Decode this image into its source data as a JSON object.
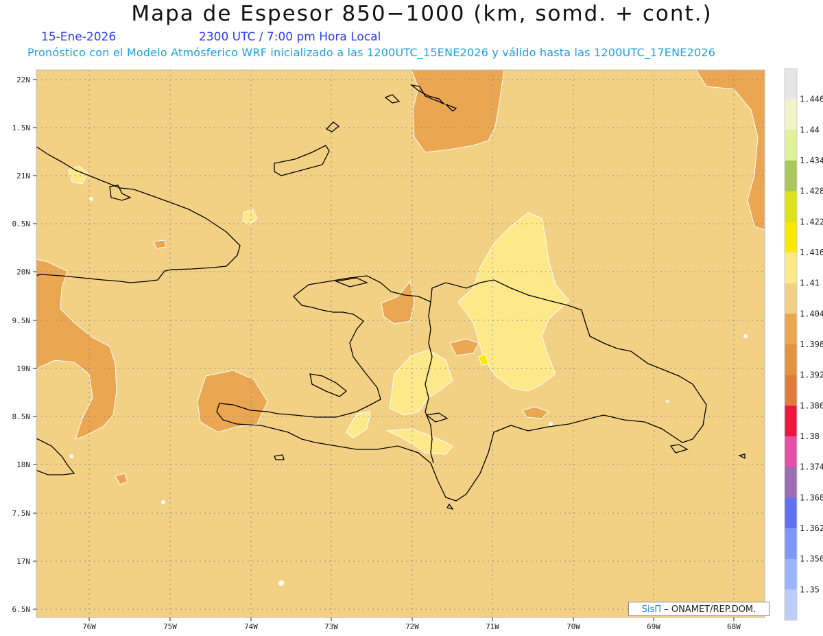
{
  "header": {
    "title": "Mapa de Espesor 850−1000 (km, somd. + cont.)",
    "date": "15-Ene-2026",
    "time": "2300 UTC / 7:00 pm Hora Local",
    "description": "Pronóstico con el Modelo Atmósferico WRF inicializado a las 1200UTC_15ENE2026 y válido hasta las  1200UTC_17ENE2026"
  },
  "axes": {
    "lat_labels": [
      "22N",
      "1.5N",
      "21N",
      "0.5N",
      "20N",
      "9.5N",
      "19N",
      "8.5N",
      "18N",
      "7.5N",
      "17N",
      "6.5N"
    ],
    "lon_labels": [
      "76W",
      "75W",
      "74W",
      "73W",
      "72W",
      "71W",
      "70W",
      "69W",
      "68W"
    ]
  },
  "legend": {
    "labels": [
      "1.446",
      "1.44",
      "1.434",
      "1.428",
      "1.422",
      "1.416",
      "1.41",
      "1.404",
      "1.398",
      "1.392",
      "1.386",
      "1.38",
      "1.374",
      "1.368",
      "1.362",
      "1.356",
      "1.35"
    ],
    "colors": [
      "#e6e6e6",
      "#f0f5c8",
      "#dff199",
      "#a8c95a",
      "#dfe21b",
      "#fbe700",
      "#fde98a",
      "#f2d184",
      "#eaa650",
      "#e49440",
      "#e07b3c",
      "#ed1640",
      "#e54fa6",
      "#9a6eb0",
      "#6270f4",
      "#7e97f7",
      "#9cb4f8",
      "#bdcdfa"
    ]
  },
  "credit": {
    "brand": "SisΠ",
    "text": "– ONAMET/REP.DOM."
  },
  "colors": {
    "background": "#f2d184",
    "darker": "#eaa650",
    "lighter": "#fde98a",
    "yellow": "#fbe700",
    "dotted_grid": "#8a8a8a"
  }
}
